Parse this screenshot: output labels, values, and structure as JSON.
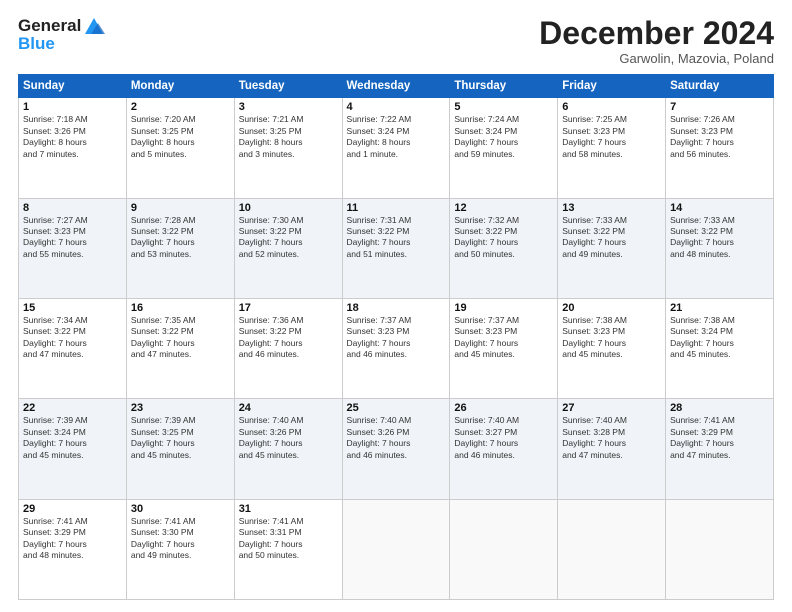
{
  "header": {
    "logo_line1": "General",
    "logo_line2": "Blue",
    "month_title": "December 2024",
    "location": "Garwolin, Mazovia, Poland"
  },
  "days_of_week": [
    "Sunday",
    "Monday",
    "Tuesday",
    "Wednesday",
    "Thursday",
    "Friday",
    "Saturday"
  ],
  "weeks": [
    [
      {
        "day": "1",
        "info": "Sunrise: 7:18 AM\nSunset: 3:26 PM\nDaylight: 8 hours\nand 7 minutes."
      },
      {
        "day": "2",
        "info": "Sunrise: 7:20 AM\nSunset: 3:25 PM\nDaylight: 8 hours\nand 5 minutes."
      },
      {
        "day": "3",
        "info": "Sunrise: 7:21 AM\nSunset: 3:25 PM\nDaylight: 8 hours\nand 3 minutes."
      },
      {
        "day": "4",
        "info": "Sunrise: 7:22 AM\nSunset: 3:24 PM\nDaylight: 8 hours\nand 1 minute."
      },
      {
        "day": "5",
        "info": "Sunrise: 7:24 AM\nSunset: 3:24 PM\nDaylight: 7 hours\nand 59 minutes."
      },
      {
        "day": "6",
        "info": "Sunrise: 7:25 AM\nSunset: 3:23 PM\nDaylight: 7 hours\nand 58 minutes."
      },
      {
        "day": "7",
        "info": "Sunrise: 7:26 AM\nSunset: 3:23 PM\nDaylight: 7 hours\nand 56 minutes."
      }
    ],
    [
      {
        "day": "8",
        "info": "Sunrise: 7:27 AM\nSunset: 3:23 PM\nDaylight: 7 hours\nand 55 minutes."
      },
      {
        "day": "9",
        "info": "Sunrise: 7:28 AM\nSunset: 3:22 PM\nDaylight: 7 hours\nand 53 minutes."
      },
      {
        "day": "10",
        "info": "Sunrise: 7:30 AM\nSunset: 3:22 PM\nDaylight: 7 hours\nand 52 minutes."
      },
      {
        "day": "11",
        "info": "Sunrise: 7:31 AM\nSunset: 3:22 PM\nDaylight: 7 hours\nand 51 minutes."
      },
      {
        "day": "12",
        "info": "Sunrise: 7:32 AM\nSunset: 3:22 PM\nDaylight: 7 hours\nand 50 minutes."
      },
      {
        "day": "13",
        "info": "Sunrise: 7:33 AM\nSunset: 3:22 PM\nDaylight: 7 hours\nand 49 minutes."
      },
      {
        "day": "14",
        "info": "Sunrise: 7:33 AM\nSunset: 3:22 PM\nDaylight: 7 hours\nand 48 minutes."
      }
    ],
    [
      {
        "day": "15",
        "info": "Sunrise: 7:34 AM\nSunset: 3:22 PM\nDaylight: 7 hours\nand 47 minutes."
      },
      {
        "day": "16",
        "info": "Sunrise: 7:35 AM\nSunset: 3:22 PM\nDaylight: 7 hours\nand 47 minutes."
      },
      {
        "day": "17",
        "info": "Sunrise: 7:36 AM\nSunset: 3:22 PM\nDaylight: 7 hours\nand 46 minutes."
      },
      {
        "day": "18",
        "info": "Sunrise: 7:37 AM\nSunset: 3:23 PM\nDaylight: 7 hours\nand 46 minutes."
      },
      {
        "day": "19",
        "info": "Sunrise: 7:37 AM\nSunset: 3:23 PM\nDaylight: 7 hours\nand 45 minutes."
      },
      {
        "day": "20",
        "info": "Sunrise: 7:38 AM\nSunset: 3:23 PM\nDaylight: 7 hours\nand 45 minutes."
      },
      {
        "day": "21",
        "info": "Sunrise: 7:38 AM\nSunset: 3:24 PM\nDaylight: 7 hours\nand 45 minutes."
      }
    ],
    [
      {
        "day": "22",
        "info": "Sunrise: 7:39 AM\nSunset: 3:24 PM\nDaylight: 7 hours\nand 45 minutes."
      },
      {
        "day": "23",
        "info": "Sunrise: 7:39 AM\nSunset: 3:25 PM\nDaylight: 7 hours\nand 45 minutes."
      },
      {
        "day": "24",
        "info": "Sunrise: 7:40 AM\nSunset: 3:26 PM\nDaylight: 7 hours\nand 45 minutes."
      },
      {
        "day": "25",
        "info": "Sunrise: 7:40 AM\nSunset: 3:26 PM\nDaylight: 7 hours\nand 46 minutes."
      },
      {
        "day": "26",
        "info": "Sunrise: 7:40 AM\nSunset: 3:27 PM\nDaylight: 7 hours\nand 46 minutes."
      },
      {
        "day": "27",
        "info": "Sunrise: 7:40 AM\nSunset: 3:28 PM\nDaylight: 7 hours\nand 47 minutes."
      },
      {
        "day": "28",
        "info": "Sunrise: 7:41 AM\nSunset: 3:29 PM\nDaylight: 7 hours\nand 47 minutes."
      }
    ],
    [
      {
        "day": "29",
        "info": "Sunrise: 7:41 AM\nSunset: 3:29 PM\nDaylight: 7 hours\nand 48 minutes."
      },
      {
        "day": "30",
        "info": "Sunrise: 7:41 AM\nSunset: 3:30 PM\nDaylight: 7 hours\nand 49 minutes."
      },
      {
        "day": "31",
        "info": "Sunrise: 7:41 AM\nSunset: 3:31 PM\nDaylight: 7 hours\nand 50 minutes."
      },
      {
        "day": "",
        "info": ""
      },
      {
        "day": "",
        "info": ""
      },
      {
        "day": "",
        "info": ""
      },
      {
        "day": "",
        "info": ""
      }
    ]
  ]
}
